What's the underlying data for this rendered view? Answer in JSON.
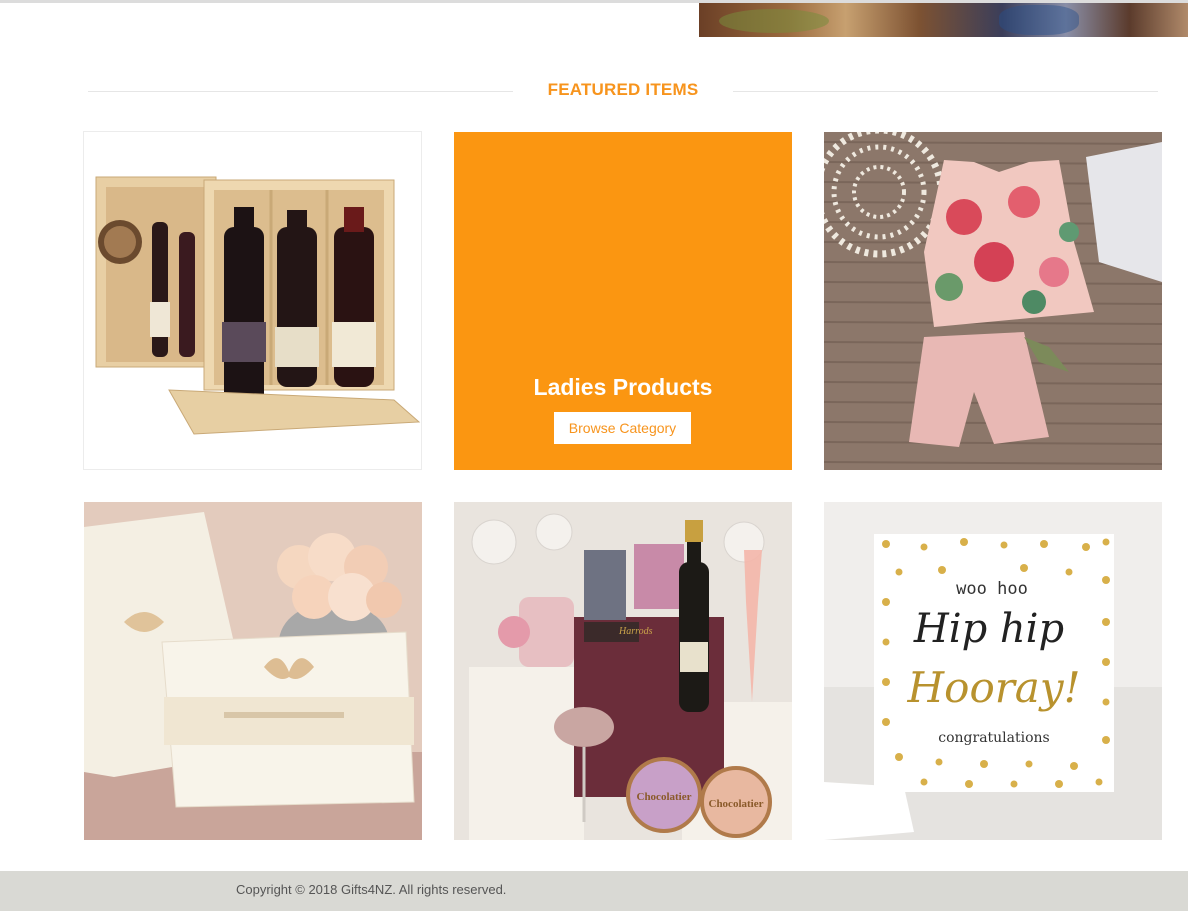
{
  "section": {
    "title": "FEATURED ITEMS"
  },
  "featured": [
    {
      "id": "wine-box",
      "alt_icon": "wine-gift-box-image"
    },
    {
      "id": "category",
      "title": "Ladies Products",
      "button_label": "Browse Category"
    },
    {
      "id": "kids-outfit",
      "alt_icon": "floral-kids-outfit-image"
    },
    {
      "id": "wedding-cards",
      "alt_icon": "wedding-invitation-image"
    },
    {
      "id": "harrods-hamper",
      "alt_icon": "luxury-hamper-image",
      "image_text": [
        "Harrods",
        "Chocolatier",
        "Chocolatier"
      ]
    },
    {
      "id": "greeting-card",
      "alt_icon": "congratulations-card-image",
      "image_text": [
        "woo hoo",
        "Hip hip",
        "Hooray!",
        "congratulations"
      ]
    }
  ],
  "footer": {
    "copyright": "Copyright © 2018 Gifts4NZ. All rights reserved."
  },
  "colors": {
    "accent": "#f7941d",
    "tile_orange": "#fb9611",
    "footer_bg": "#d9d9d4"
  }
}
